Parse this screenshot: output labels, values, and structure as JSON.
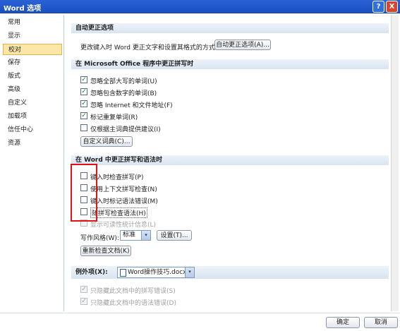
{
  "window": {
    "title": "Word 选项",
    "help": "?",
    "close": "X"
  },
  "sidebar": {
    "items": [
      {
        "label": "常用",
        "selected": false
      },
      {
        "label": "显示",
        "selected": false
      },
      {
        "label": "校对",
        "selected": true
      },
      {
        "label": "保存",
        "selected": false
      },
      {
        "label": "版式",
        "selected": false
      },
      {
        "label": "高级",
        "selected": false
      },
      {
        "label": "自定义",
        "selected": false
      },
      {
        "label": "加载项",
        "selected": false
      },
      {
        "label": "信任中心",
        "selected": false
      },
      {
        "label": "资源",
        "selected": false
      }
    ]
  },
  "autocorrect": {
    "header": "自动更正选项",
    "description": "更改键入时 Word 更正文字和设置其格式的方式:",
    "button": "自动更正选项(A)..."
  },
  "office": {
    "header": "在 Microsoft Office 程序中更正拼写时",
    "options": [
      {
        "label": "忽略全部大写的单词(U)",
        "checked": true
      },
      {
        "label": "忽略包含数字的单词(B)",
        "checked": true
      },
      {
        "label": "忽略 Internet 和文件地址(F)",
        "checked": true
      },
      {
        "label": "标记重复单词(R)",
        "checked": true
      },
      {
        "label": "仅根据主词典提供建议(I)",
        "checked": false
      }
    ],
    "dict_button": "自定义词典(C)..."
  },
  "word": {
    "header": "在 Word 中更正拼写和语法时",
    "options": [
      {
        "label": "键入时检查拼写(P)",
        "checked": false
      },
      {
        "label": "使用上下文拼写检查(N)",
        "checked": false
      },
      {
        "label": "键入时标记语法错误(M)",
        "checked": false
      },
      {
        "label": "随拼写检查语法(H)",
        "checked": false
      }
    ],
    "readability": "显示可读性统计信息(L)",
    "style_label": "写作风格(W):",
    "style_value": "标准",
    "settings_button": "设置(T)...",
    "recheck_button": "重新检查文档(K)"
  },
  "exceptions": {
    "label": "例外项(X):",
    "document": "Word操作技巧.docx",
    "options": [
      {
        "label": "只隐藏此文档中的拼写错误(S)",
        "checked": true
      },
      {
        "label": "只隐藏此文档中的语法错误(D)",
        "checked": true
      }
    ]
  },
  "footer": {
    "ok": "确定",
    "cancel": "取消"
  },
  "colors": {
    "accent": "#2a63d6",
    "selected_nav": "#fde7a8",
    "highlight_box": "#e31313",
    "checkmark": "#1a7a1a"
  },
  "icons": {
    "dropdown": "▾",
    "check": "✓"
  }
}
